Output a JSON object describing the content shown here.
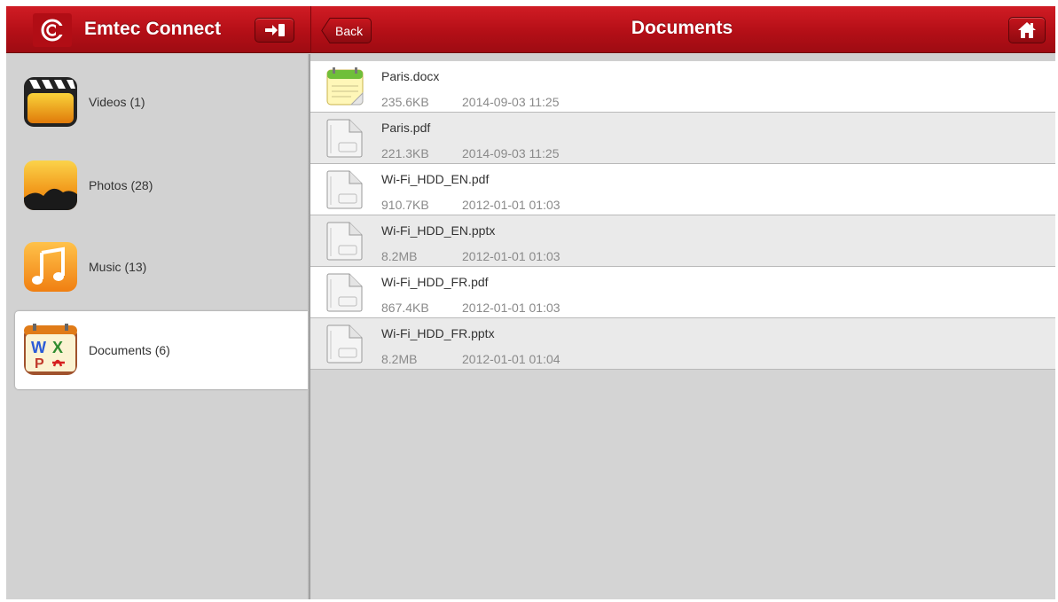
{
  "header": {
    "app_title": "Emtec Connect",
    "back_label": "Back",
    "page_title": "Documents"
  },
  "icons": {
    "logo": "emtec-logo-icon",
    "logout": "logout-icon",
    "home": "home-icon",
    "videos": "video-clapper-icon",
    "photos": "photo-landscape-icon",
    "music": "music-note-icon",
    "documents": "documents-icon",
    "docx": "notepad-icon",
    "file": "generic-file-icon"
  },
  "colors": {
    "header_red": "#b40f17",
    "sidebar_bg": "#d2d2d2",
    "list_alt_row": "#eaeaea",
    "meta_text": "#8a8a8a"
  },
  "sidebar": {
    "items": [
      {
        "label": "Videos (1)",
        "active": false
      },
      {
        "label": "Photos (28)",
        "active": false
      },
      {
        "label": "Music (13)",
        "active": false
      },
      {
        "label": "Documents (6)",
        "active": true
      }
    ]
  },
  "files": [
    {
      "name": "Paris.docx",
      "size": "235.6KB",
      "date": "2014-09-03 11:25",
      "type": "docx"
    },
    {
      "name": "Paris.pdf",
      "size": "221.3KB",
      "date": "2014-09-03 11:25",
      "type": "file"
    },
    {
      "name": "Wi-Fi_HDD_EN.pdf",
      "size": "910.7KB",
      "date": "2012-01-01 01:03",
      "type": "file"
    },
    {
      "name": "Wi-Fi_HDD_EN.pptx",
      "size": "8.2MB",
      "date": "2012-01-01 01:03",
      "type": "file"
    },
    {
      "name": "Wi-Fi_HDD_FR.pdf",
      "size": "867.4KB",
      "date": "2012-01-01 01:03",
      "type": "file"
    },
    {
      "name": "Wi-Fi_HDD_FR.pptx",
      "size": "8.2MB",
      "date": "2012-01-01 01:04",
      "type": "file"
    }
  ]
}
